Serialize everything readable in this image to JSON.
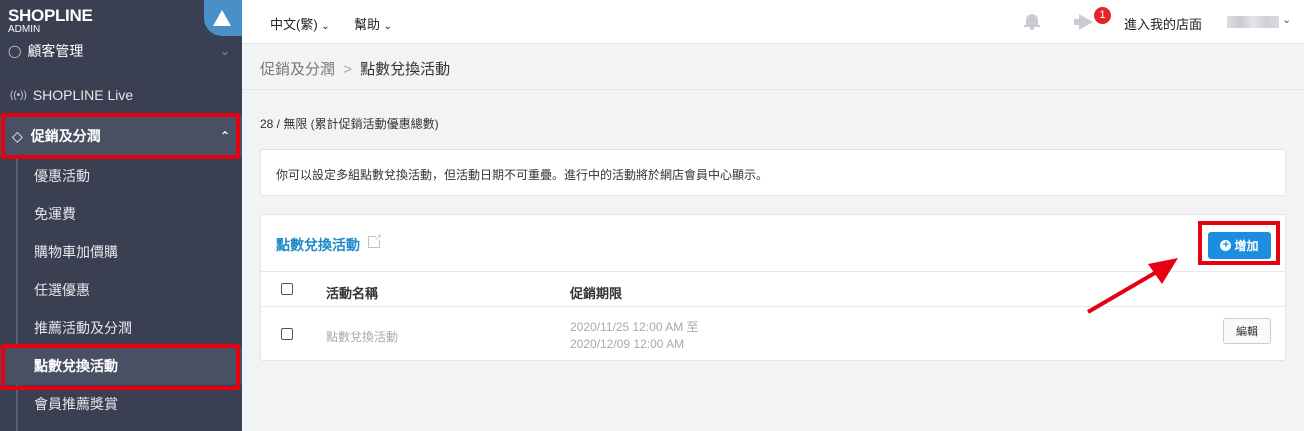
{
  "brand": {
    "logo": "SHOPLINE",
    "sub": "ADMIN"
  },
  "sidebar": {
    "customers": "顧客管理",
    "live": "SHOPLINE Live",
    "promotions": "促銷及分潤",
    "sub_items": [
      "優惠活動",
      "免運費",
      "購物車加價購",
      "任選優惠",
      "推薦活動及分潤",
      "點數兌換活動",
      "會員推薦獎賞"
    ]
  },
  "topbar": {
    "language": "中文(繁)",
    "help": "幫助",
    "notification_count": "1",
    "enter_shop": "進入我的店面"
  },
  "breadcrumb": {
    "parent": "促銷及分潤",
    "separator": ">",
    "current": "點數兌換活動"
  },
  "usage_count": "28 / 無限 (累計促銷活動優惠總數)",
  "notice": "你可以設定多組點數兌換活動，但活動日期不可重疊。進行中的活動將於網店會員中心顯示。",
  "panel": {
    "title": "點數兌換活動",
    "add_label": "增加",
    "columns": [
      "活動名稱",
      "促銷期限"
    ],
    "rows": [
      {
        "name": "點數兌換活動",
        "start": "2020/11/25 12:00 AM 至",
        "end": "2020/12/09 12:00 AM",
        "action": "編輯"
      }
    ]
  },
  "colors": {
    "sidebar": "#3a3f51",
    "highlight": "#e50012",
    "primary": "#1b8ee0",
    "link": "#1e88c8"
  }
}
